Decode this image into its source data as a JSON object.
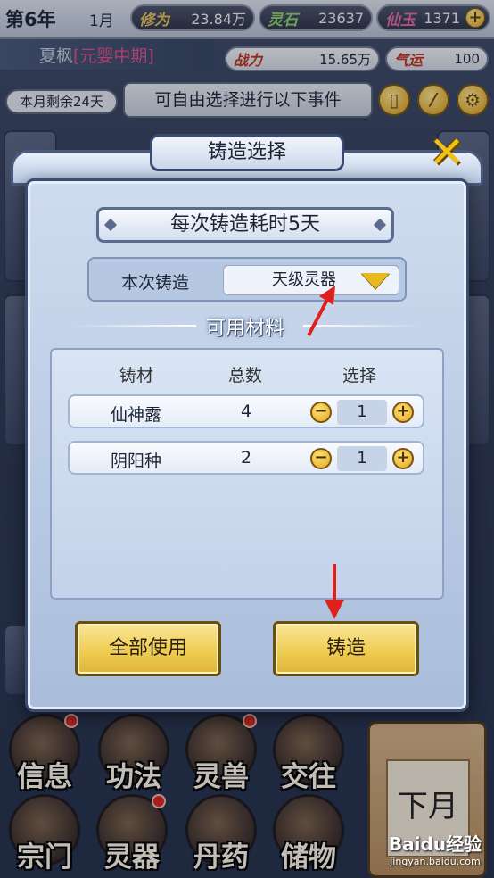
{
  "top": {
    "year": "第6年",
    "month": "1月",
    "resources": [
      {
        "label": "修为",
        "value": "23.84万",
        "color": "#e7c35a"
      },
      {
        "label": "灵石",
        "value": "23637",
        "color": "#8fd46a"
      },
      {
        "label": "仙玉",
        "value": "1371",
        "color": "#e76aa0"
      }
    ],
    "name": "夏枫",
    "realm": "[元婴中期]",
    "stats": [
      {
        "label": "战力",
        "value": "15.65万"
      },
      {
        "label": "气运",
        "value": "100"
      }
    ],
    "days_left": "本月剩余24天",
    "hint": "可自由选择进行以下事件"
  },
  "dialog": {
    "title": "铸造选择",
    "time_text": "每次铸造耗时5天",
    "forge_label": "本次铸造",
    "forge_value": "天级灵器",
    "materials_title": "可用材料",
    "headers": [
      "铸材",
      "总数",
      "选择"
    ],
    "materials": [
      {
        "name": "仙神露",
        "total": "4",
        "selected": "1"
      },
      {
        "name": "阴阳种",
        "total": "2",
        "selected": "1"
      }
    ],
    "use_all_label": "全部使用",
    "forge_button_label": "铸造"
  },
  "bottom_menu": [
    {
      "label": "信息"
    },
    {
      "label": "功法"
    },
    {
      "label": "灵兽"
    },
    {
      "label": "交往"
    },
    {
      "label": "宗门"
    },
    {
      "label": "灵器"
    },
    {
      "label": "丹药"
    },
    {
      "label": "储物"
    }
  ],
  "next_month_label": "下月",
  "watermark": {
    "brand": "Baidu经验",
    "url": "jingyan.baidu.com"
  },
  "colors": {
    "accent_gold": "#f0cd52",
    "annotation_red": "#e0201c",
    "realm_pink": "#e05088"
  }
}
